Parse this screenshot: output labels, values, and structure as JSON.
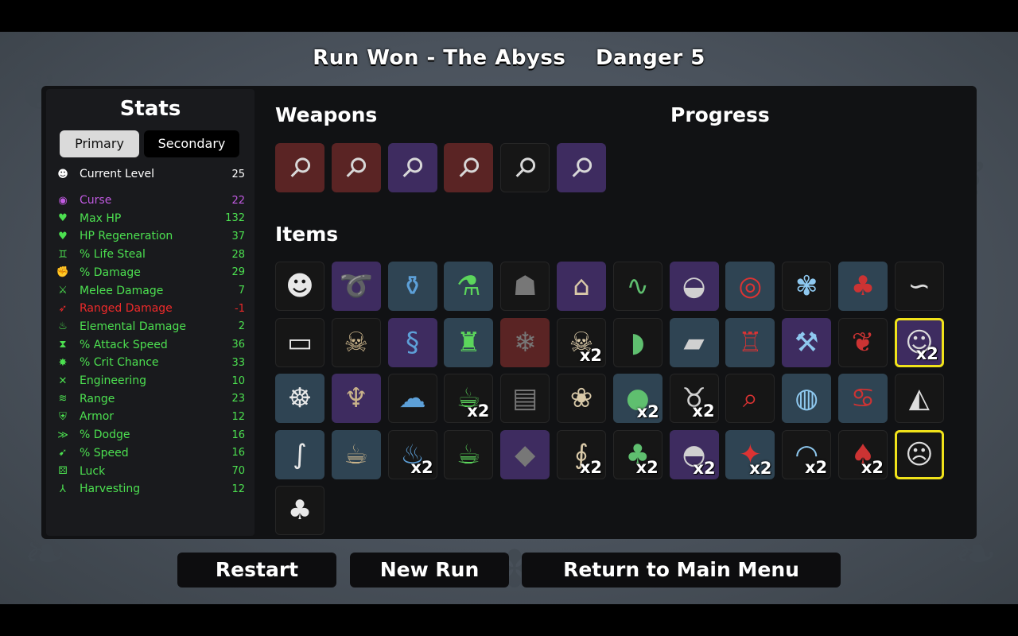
{
  "header": {
    "run_title": "Run Won - The Abyss",
    "danger": "Danger 5"
  },
  "stats": {
    "title": "Stats",
    "tabs": {
      "primary": "Primary",
      "secondary": "Secondary"
    },
    "level": {
      "label": "Current Level",
      "value": "25",
      "icon": "skull-icon",
      "color": "#ffffff"
    },
    "items": [
      {
        "label": "Curse",
        "value": "22",
        "color": "#c05ae0",
        "icon": "curse-eye-icon"
      },
      {
        "label": "Max HP",
        "value": "132",
        "color": "#4ce050",
        "icon": "heart-icon"
      },
      {
        "label": "HP Regeneration",
        "value": "37",
        "color": "#4ce050",
        "icon": "heart-plus-icon"
      },
      {
        "label": "% Life Steal",
        "value": "28",
        "color": "#4ce050",
        "icon": "fangs-icon"
      },
      {
        "label": "% Damage",
        "value": "29",
        "color": "#4ce050",
        "icon": "muscle-icon"
      },
      {
        "label": "Melee Damage",
        "value": "7",
        "color": "#4ce050",
        "icon": "sword-icon"
      },
      {
        "label": "Ranged Damage",
        "value": "-1",
        "color": "#ee2a2a",
        "icon": "bow-icon"
      },
      {
        "label": "Elemental Damage",
        "value": "2",
        "color": "#4ce050",
        "icon": "flame-icon"
      },
      {
        "label": "% Attack Speed",
        "value": "36",
        "color": "#4ce050",
        "icon": "hourglass-icon"
      },
      {
        "label": "% Crit Chance",
        "value": "33",
        "color": "#4ce050",
        "icon": "crit-burst-icon"
      },
      {
        "label": "Engineering",
        "value": "10",
        "color": "#4ce050",
        "icon": "wrench-icon"
      },
      {
        "label": "Range",
        "value": "23",
        "color": "#4ce050",
        "icon": "range-waves-icon"
      },
      {
        "label": "Armor",
        "value": "12",
        "color": "#4ce050",
        "icon": "shield-icon"
      },
      {
        "label": "% Dodge",
        "value": "16",
        "color": "#4ce050",
        "icon": "dodge-wind-icon"
      },
      {
        "label": "% Speed",
        "value": "16",
        "color": "#4ce050",
        "icon": "boot-icon"
      },
      {
        "label": "Luck",
        "value": "70",
        "color": "#4ce050",
        "icon": "dice-icon"
      },
      {
        "label": "Harvesting",
        "value": "12",
        "color": "#4ce050",
        "icon": "wheat-icon"
      }
    ]
  },
  "weapons": {
    "title": "Weapons",
    "items": [
      {
        "name": "spoon-weapon-icon",
        "tier": 3,
        "glyph": "⚲"
      },
      {
        "name": "spoon-weapon-icon",
        "tier": 3,
        "glyph": "⚲"
      },
      {
        "name": "spoon-weapon-icon",
        "tier": 2,
        "glyph": "⚲"
      },
      {
        "name": "spoon-weapon-icon",
        "tier": 3,
        "glyph": "⚲"
      },
      {
        "name": "spoon-weapon-icon",
        "tier": 0,
        "glyph": "⚲"
      },
      {
        "name": "spoon-weapon-icon",
        "tier": 2,
        "glyph": "⚲"
      }
    ]
  },
  "progress": {
    "title": "Progress"
  },
  "items": {
    "title": "Items",
    "list": [
      {
        "name": "alien-mask-icon",
        "tier": 0,
        "glyph": "☻",
        "count": ""
      },
      {
        "name": "rope-icon",
        "tier": 2,
        "glyph": "➰",
        "count": ""
      },
      {
        "name": "jar-icon",
        "tier": 1,
        "glyph": "⚱",
        "count": ""
      },
      {
        "name": "potion-flask-icon",
        "tier": 1,
        "glyph": "⚗",
        "count": ""
      },
      {
        "name": "cat-icon",
        "tier": 0,
        "glyph": "☗",
        "count": ""
      },
      {
        "name": "cloth-icon",
        "tier": 2,
        "glyph": "⌂",
        "count": ""
      },
      {
        "name": "snake-icon",
        "tier": 0,
        "glyph": "∿",
        "count": ""
      },
      {
        "name": "jellyfish-icon",
        "tier": 2,
        "glyph": "◒",
        "count": ""
      },
      {
        "name": "ring-icon",
        "tier": 1,
        "glyph": "◎",
        "count": ""
      },
      {
        "name": "butterfly-icon",
        "tier": 0,
        "glyph": "✾",
        "count": ""
      },
      {
        "name": "cherry-knife-icon",
        "tier": 1,
        "glyph": "♣",
        "count": ""
      },
      {
        "name": "lizard-icon",
        "tier": 0,
        "glyph": "∽",
        "count": ""
      },
      {
        "name": "banknote-icon",
        "tier": 0,
        "glyph": "▭",
        "count": ""
      },
      {
        "name": "alien-skull-icon",
        "tier": 0,
        "glyph": "☠",
        "count": ""
      },
      {
        "name": "scarf-icon",
        "tier": 2,
        "glyph": "§",
        "count": ""
      },
      {
        "name": "helmet-icon",
        "tier": 1,
        "glyph": "♜",
        "count": ""
      },
      {
        "name": "snowflake-icon",
        "tier": 3,
        "glyph": "❄",
        "count": ""
      },
      {
        "name": "skull-icon",
        "tier": 0,
        "glyph": "☠",
        "count": "x2"
      },
      {
        "name": "fang-icon",
        "tier": 0,
        "glyph": "◗",
        "count": ""
      },
      {
        "name": "plank-icon",
        "tier": 1,
        "glyph": "▰",
        "count": ""
      },
      {
        "name": "fortress-icon",
        "tier": 1,
        "glyph": "♖",
        "count": ""
      },
      {
        "name": "screw-icon",
        "tier": 2,
        "glyph": "⚒",
        "count": ""
      },
      {
        "name": "squirrel-icon",
        "tier": 0,
        "glyph": "❦",
        "count": ""
      },
      {
        "name": "bunny-icon",
        "tier": 2,
        "glyph": "☺",
        "count": "x2",
        "selected": true
      },
      {
        "name": "octopus-icon",
        "tier": 1,
        "glyph": "☸",
        "count": ""
      },
      {
        "name": "antler-beast-icon",
        "tier": 2,
        "glyph": "♆",
        "count": ""
      },
      {
        "name": "slime-icon",
        "tier": 0,
        "glyph": "☁",
        "count": ""
      },
      {
        "name": "acorn-icon",
        "tier": 0,
        "glyph": "☕",
        "count": "x2"
      },
      {
        "name": "armor-vest-icon",
        "tier": 0,
        "glyph": "▤",
        "count": ""
      },
      {
        "name": "seahorse-icon",
        "tier": 0,
        "glyph": "❀",
        "count": ""
      },
      {
        "name": "pearl-icon",
        "tier": 1,
        "glyph": "●",
        "count": "x2"
      },
      {
        "name": "alien-icon",
        "tier": 0,
        "glyph": "♉",
        "count": "x2"
      },
      {
        "name": "spyglass-icon",
        "tier": 0,
        "glyph": "⌕",
        "count": ""
      },
      {
        "name": "robot-head-icon",
        "tier": 1,
        "glyph": "◍",
        "count": ""
      },
      {
        "name": "piggy-bank-icon",
        "tier": 1,
        "glyph": "♋",
        "count": ""
      },
      {
        "name": "anglerfish-icon",
        "tier": 0,
        "glyph": "◭",
        "count": ""
      },
      {
        "name": "worm-icon",
        "tier": 1,
        "glyph": "∫",
        "count": ""
      },
      {
        "name": "tea-cup-icon",
        "tier": 1,
        "glyph": "☕",
        "count": ""
      },
      {
        "name": "red-blob-icon",
        "tier": 0,
        "glyph": "♨",
        "count": "x2"
      },
      {
        "name": "coffee-mug-icon",
        "tier": 0,
        "glyph": "☕",
        "count": ""
      },
      {
        "name": "crystal-block-icon",
        "tier": 2,
        "glyph": "◆",
        "count": ""
      },
      {
        "name": "tentacle-icon",
        "tier": 0,
        "glyph": "∮",
        "count": "x2"
      },
      {
        "name": "palm-tree-icon",
        "tier": 0,
        "glyph": "♣",
        "count": "x2"
      },
      {
        "name": "brain-icon",
        "tier": 2,
        "glyph": "◓",
        "count": "x2"
      },
      {
        "name": "claw-shard-icon",
        "tier": 1,
        "glyph": "✦",
        "count": "x2"
      },
      {
        "name": "propeller-hat-icon",
        "tier": 0,
        "glyph": "◠",
        "count": "x2"
      },
      {
        "name": "mushroom-icon",
        "tier": 0,
        "glyph": "♠",
        "count": "x2"
      },
      {
        "name": "monkey-icon",
        "tier": 0,
        "glyph": "☹",
        "count": "",
        "selected": true
      },
      {
        "name": "tree-icon",
        "tier": 0,
        "glyph": "♣",
        "count": ""
      }
    ]
  },
  "buttons": {
    "restart": "Restart",
    "new_run": "New Run",
    "main_menu": "Return to Main Menu"
  }
}
